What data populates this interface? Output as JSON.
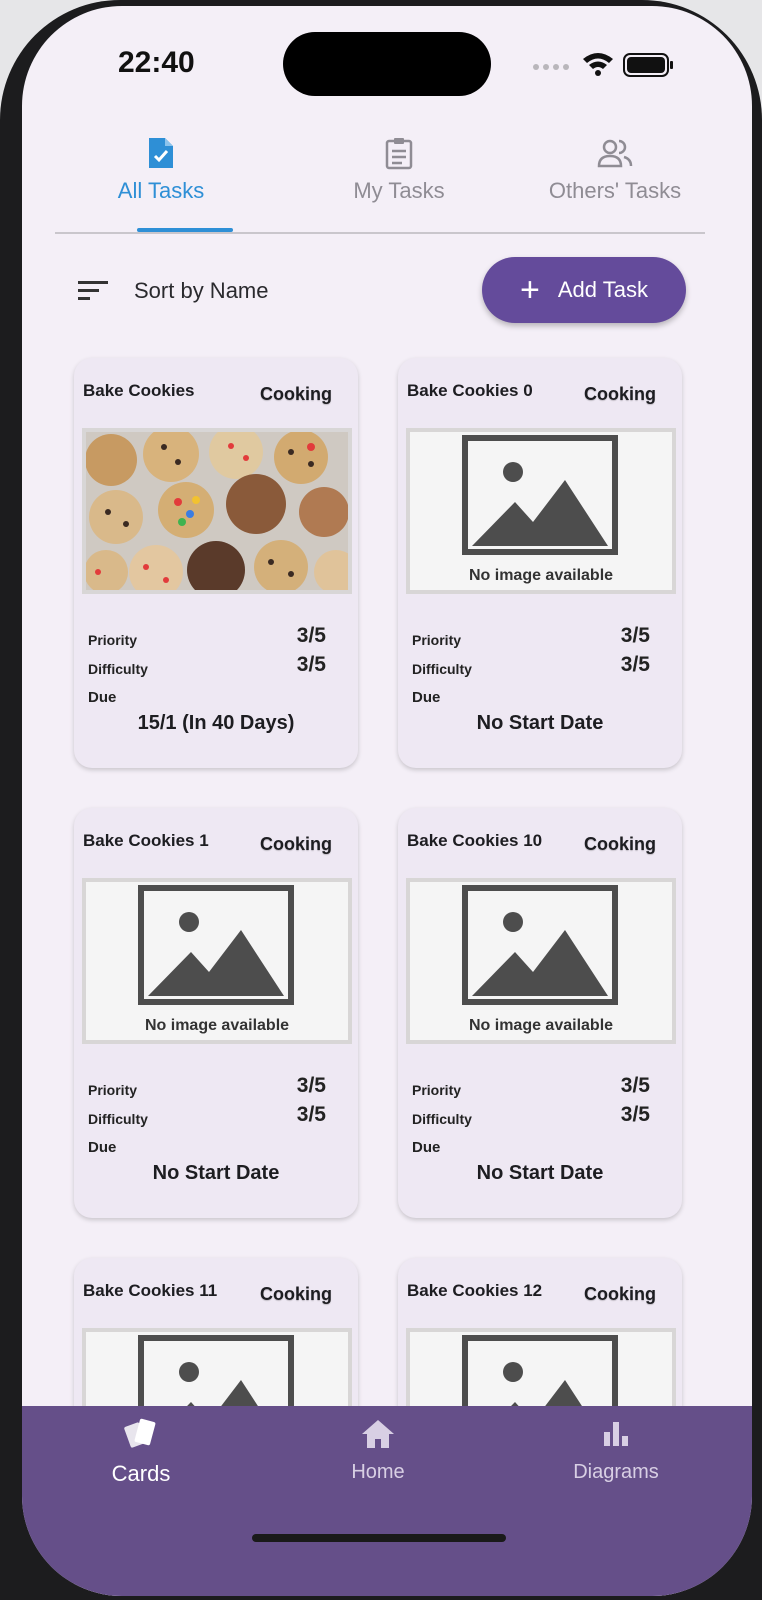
{
  "status_bar": {
    "time": "22:40"
  },
  "tabs": [
    {
      "label": "All Tasks",
      "icon": "task-doc-icon",
      "active": true
    },
    {
      "label": "My Tasks",
      "icon": "clipboard-icon",
      "active": false
    },
    {
      "label": "Others' Tasks",
      "icon": "people-icon",
      "active": false
    }
  ],
  "toolbar": {
    "sort_label": "Sort by Name",
    "add_label": "Add Task"
  },
  "labels": {
    "priority": "Priority",
    "difficulty": "Difficulty",
    "due": "Due",
    "no_image": "No image available"
  },
  "cards": [
    {
      "name": "Bake Cookies",
      "category": "Cooking",
      "priority": "3/5",
      "difficulty": "3/5",
      "due": "15/1 (In 40 Days)",
      "has_image": true
    },
    {
      "name": "Bake Cookies 0",
      "category": "Cooking",
      "priority": "3/5",
      "difficulty": "3/5",
      "due": "No Start Date",
      "has_image": false
    },
    {
      "name": "Bake Cookies 1",
      "category": "Cooking",
      "priority": "3/5",
      "difficulty": "3/5",
      "due": "No Start Date",
      "has_image": false
    },
    {
      "name": "Bake Cookies 10",
      "category": "Cooking",
      "priority": "3/5",
      "difficulty": "3/5",
      "due": "No Start Date",
      "has_image": false
    },
    {
      "name": "Bake Cookies 11",
      "category": "Cooking"
    },
    {
      "name": "Bake Cookies 12",
      "category": "Cooking"
    }
  ],
  "bottom_nav": [
    {
      "label": "Cards",
      "icon": "cards-icon",
      "active": true
    },
    {
      "label": "Home",
      "icon": "home-icon",
      "active": false
    },
    {
      "label": "Diagrams",
      "icon": "bar-chart-icon",
      "active": false
    }
  ],
  "colors": {
    "accent_tab": "#2e8fd6",
    "primary": "#644b9b",
    "nav_bg": "#654f89",
    "card_bg": "#eee8f3",
    "screen_bg": "#f4eff7"
  }
}
